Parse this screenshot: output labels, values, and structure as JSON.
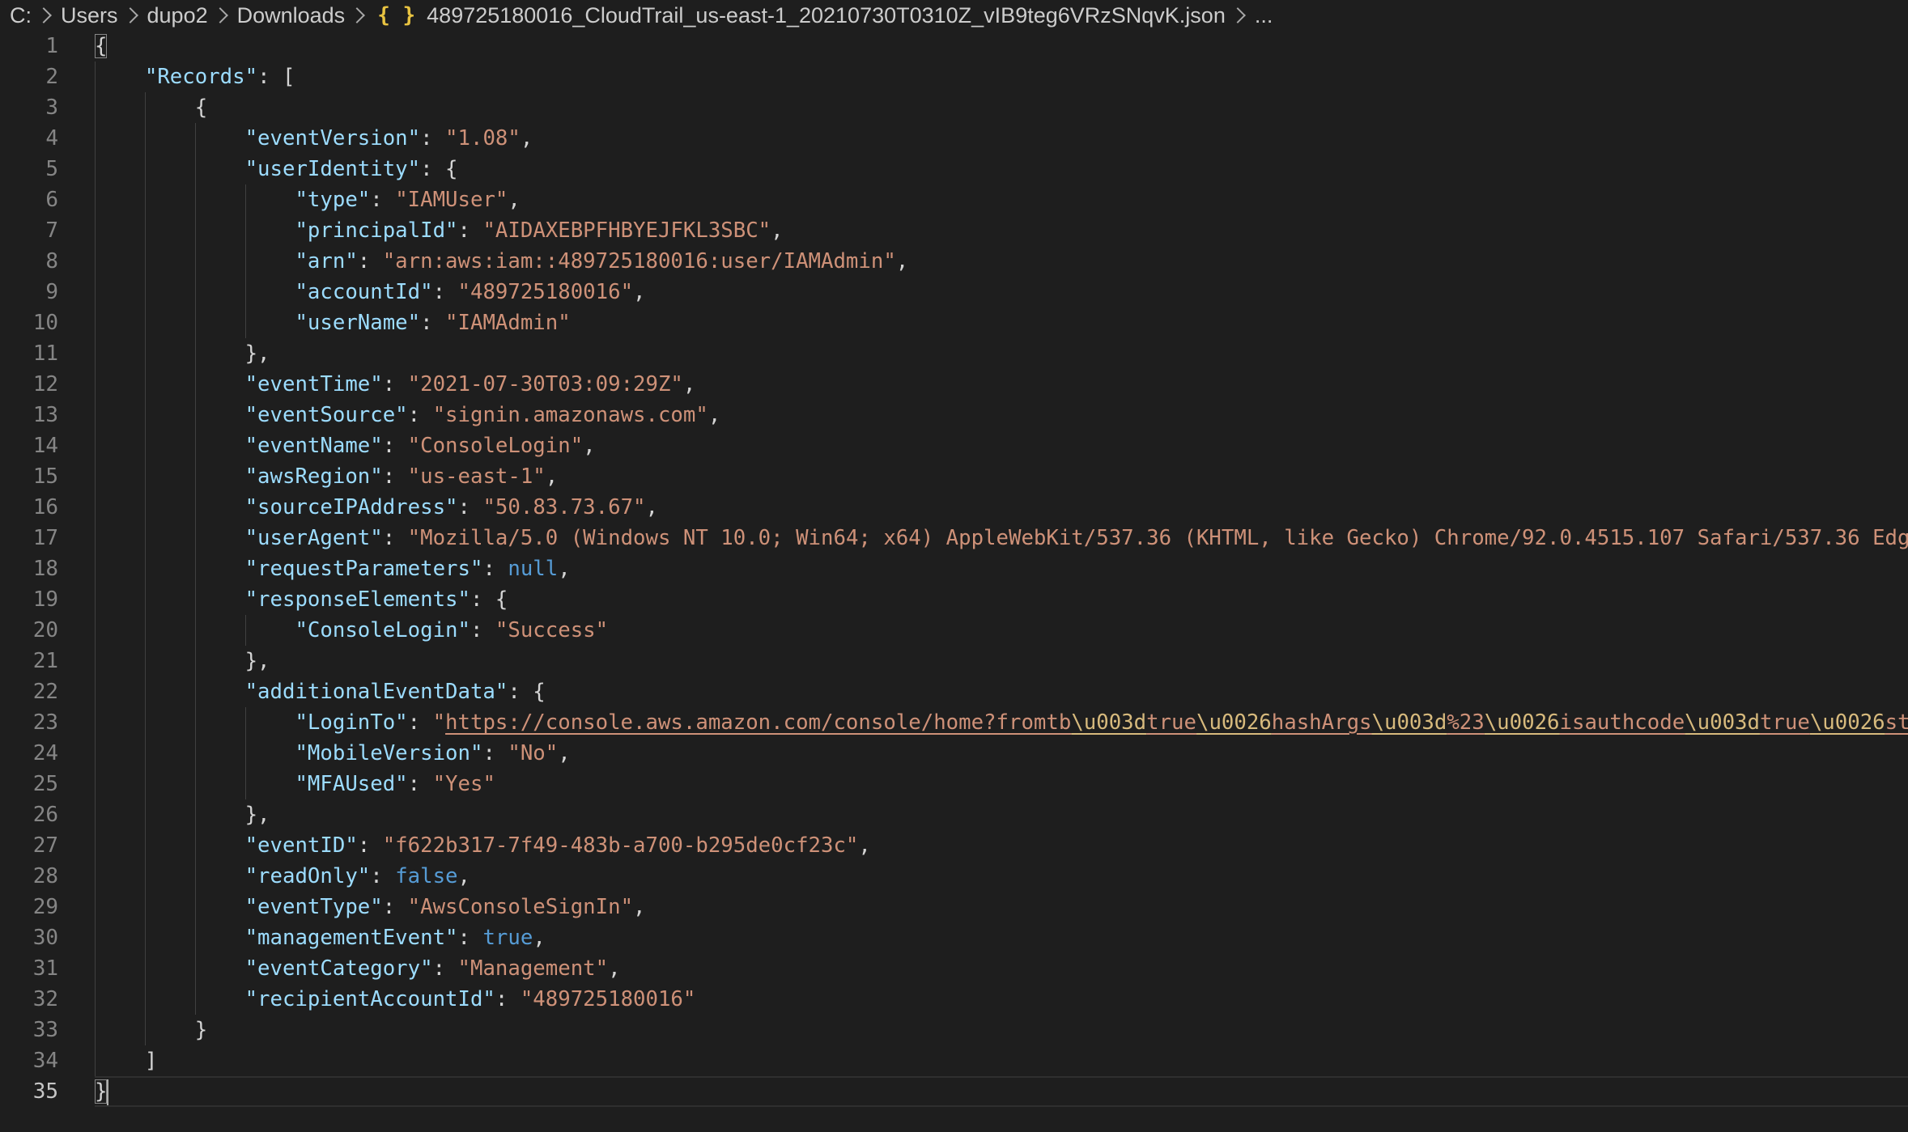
{
  "breadcrumb": {
    "items": [
      "C:",
      "Users",
      "dupo2",
      "Downloads"
    ],
    "file_icon": "{ }",
    "file_name": "489725180016_CloudTrail_us-east-1_20210730T0310Z_vIB9teg6VRzSNqvK.json",
    "more": "..."
  },
  "editor": {
    "active_line": 35,
    "lines": [
      [
        [
          "p",
          "{"
        ]
      ],
      [
        [
          "p",
          "    "
        ],
        [
          "k",
          "\"Records\""
        ],
        [
          "p",
          ": ["
        ]
      ],
      [
        [
          "p",
          "        {"
        ]
      ],
      [
        [
          "p",
          "            "
        ],
        [
          "k",
          "\"eventVersion\""
        ],
        [
          "p",
          ": "
        ],
        [
          "s",
          "\"1.08\""
        ],
        [
          "p",
          ","
        ]
      ],
      [
        [
          "p",
          "            "
        ],
        [
          "k",
          "\"userIdentity\""
        ],
        [
          "p",
          ": {"
        ]
      ],
      [
        [
          "p",
          "                "
        ],
        [
          "k",
          "\"type\""
        ],
        [
          "p",
          ": "
        ],
        [
          "s",
          "\"IAMUser\""
        ],
        [
          "p",
          ","
        ]
      ],
      [
        [
          "p",
          "                "
        ],
        [
          "k",
          "\"principalId\""
        ],
        [
          "p",
          ": "
        ],
        [
          "s",
          "\"AIDAXEBPFHBYEJFKL3SBC\""
        ],
        [
          "p",
          ","
        ]
      ],
      [
        [
          "p",
          "                "
        ],
        [
          "k",
          "\"arn\""
        ],
        [
          "p",
          ": "
        ],
        [
          "s",
          "\"arn:aws:iam::489725180016:user/IAMAdmin\""
        ],
        [
          "p",
          ","
        ]
      ],
      [
        [
          "p",
          "                "
        ],
        [
          "k",
          "\"accountId\""
        ],
        [
          "p",
          ": "
        ],
        [
          "s",
          "\"489725180016\""
        ],
        [
          "p",
          ","
        ]
      ],
      [
        [
          "p",
          "                "
        ],
        [
          "k",
          "\"userName\""
        ],
        [
          "p",
          ": "
        ],
        [
          "s",
          "\"IAMAdmin\""
        ]
      ],
      [
        [
          "p",
          "            },"
        ]
      ],
      [
        [
          "p",
          "            "
        ],
        [
          "k",
          "\"eventTime\""
        ],
        [
          "p",
          ": "
        ],
        [
          "s",
          "\"2021-07-30T03:09:29Z\""
        ],
        [
          "p",
          ","
        ]
      ],
      [
        [
          "p",
          "            "
        ],
        [
          "k",
          "\"eventSource\""
        ],
        [
          "p",
          ": "
        ],
        [
          "s",
          "\"signin.amazonaws.com\""
        ],
        [
          "p",
          ","
        ]
      ],
      [
        [
          "p",
          "            "
        ],
        [
          "k",
          "\"eventName\""
        ],
        [
          "p",
          ": "
        ],
        [
          "s",
          "\"ConsoleLogin\""
        ],
        [
          "p",
          ","
        ]
      ],
      [
        [
          "p",
          "            "
        ],
        [
          "k",
          "\"awsRegion\""
        ],
        [
          "p",
          ": "
        ],
        [
          "s",
          "\"us-east-1\""
        ],
        [
          "p",
          ","
        ]
      ],
      [
        [
          "p",
          "            "
        ],
        [
          "k",
          "\"sourceIPAddress\""
        ],
        [
          "p",
          ": "
        ],
        [
          "s",
          "\"50.83.73.67\""
        ],
        [
          "p",
          ","
        ]
      ],
      [
        [
          "p",
          "            "
        ],
        [
          "k",
          "\"userAgent\""
        ],
        [
          "p",
          ": "
        ],
        [
          "s",
          "\"Mozilla/5.0 (Windows NT 10.0; Win64; x64) AppleWebKit/537.36 (KHTML, like Gecko) Chrome/92.0.4515.107 Safari/537.36 Edg"
        ]
      ],
      [
        [
          "p",
          "            "
        ],
        [
          "k",
          "\"requestParameters\""
        ],
        [
          "p",
          ": "
        ],
        [
          "c",
          "null"
        ],
        [
          "p",
          ","
        ]
      ],
      [
        [
          "p",
          "            "
        ],
        [
          "k",
          "\"responseElements\""
        ],
        [
          "p",
          ": {"
        ]
      ],
      [
        [
          "p",
          "                "
        ],
        [
          "k",
          "\"ConsoleLogin\""
        ],
        [
          "p",
          ": "
        ],
        [
          "s",
          "\"Success\""
        ]
      ],
      [
        [
          "p",
          "            },"
        ]
      ],
      [
        [
          "p",
          "            "
        ],
        [
          "k",
          "\"additionalEventData\""
        ],
        [
          "p",
          ": {"
        ]
      ],
      [
        [
          "p",
          "                "
        ],
        [
          "k",
          "\"LoginTo\""
        ],
        [
          "p",
          ": "
        ],
        [
          "s",
          "\""
        ],
        [
          "su",
          "https://console.aws.amazon.com/console/home?fromtb"
        ],
        [
          "eu",
          "\\u003d"
        ],
        [
          "su",
          "true"
        ],
        [
          "eu",
          "\\u0026"
        ],
        [
          "su",
          "hashArgs"
        ],
        [
          "eu",
          "\\u003d"
        ],
        [
          "su",
          "%23"
        ],
        [
          "eu",
          "\\u0026"
        ],
        [
          "su",
          "isauthcode"
        ],
        [
          "eu",
          "\\u003d"
        ],
        [
          "su",
          "true"
        ],
        [
          "eu",
          "\\u0026"
        ],
        [
          "su",
          "sta"
        ]
      ],
      [
        [
          "p",
          "                "
        ],
        [
          "k",
          "\"MobileVersion\""
        ],
        [
          "p",
          ": "
        ],
        [
          "s",
          "\"No\""
        ],
        [
          "p",
          ","
        ]
      ],
      [
        [
          "p",
          "                "
        ],
        [
          "k",
          "\"MFAUsed\""
        ],
        [
          "p",
          ": "
        ],
        [
          "s",
          "\"Yes\""
        ]
      ],
      [
        [
          "p",
          "            },"
        ]
      ],
      [
        [
          "p",
          "            "
        ],
        [
          "k",
          "\"eventID\""
        ],
        [
          "p",
          ": "
        ],
        [
          "s",
          "\"f622b317-7f49-483b-a700-b295de0cf23c\""
        ],
        [
          "p",
          ","
        ]
      ],
      [
        [
          "p",
          "            "
        ],
        [
          "k",
          "\"readOnly\""
        ],
        [
          "p",
          ": "
        ],
        [
          "c",
          "false"
        ],
        [
          "p",
          ","
        ]
      ],
      [
        [
          "p",
          "            "
        ],
        [
          "k",
          "\"eventType\""
        ],
        [
          "p",
          ": "
        ],
        [
          "s",
          "\"AwsConsoleSignIn\""
        ],
        [
          "p",
          ","
        ]
      ],
      [
        [
          "p",
          "            "
        ],
        [
          "k",
          "\"managementEvent\""
        ],
        [
          "p",
          ": "
        ],
        [
          "c",
          "true"
        ],
        [
          "p",
          ","
        ]
      ],
      [
        [
          "p",
          "            "
        ],
        [
          "k",
          "\"eventCategory\""
        ],
        [
          "p",
          ": "
        ],
        [
          "s",
          "\"Management\""
        ],
        [
          "p",
          ","
        ]
      ],
      [
        [
          "p",
          "            "
        ],
        [
          "k",
          "\"recipientAccountId\""
        ],
        [
          "p",
          ": "
        ],
        [
          "s",
          "\"489725180016\""
        ]
      ],
      [
        [
          "p",
          "        }"
        ]
      ],
      [
        [
          "p",
          "    ]"
        ]
      ],
      [
        [
          "p",
          "}"
        ]
      ]
    ]
  },
  "colors": {
    "background": "#1e1e1e",
    "key": "#9cdcfe",
    "string": "#ce9178",
    "constant": "#569cd6",
    "escape": "#d7ba7d",
    "punctuation": "#d4d4d4",
    "line_number": "#858585",
    "json_icon": "#e8c341"
  }
}
